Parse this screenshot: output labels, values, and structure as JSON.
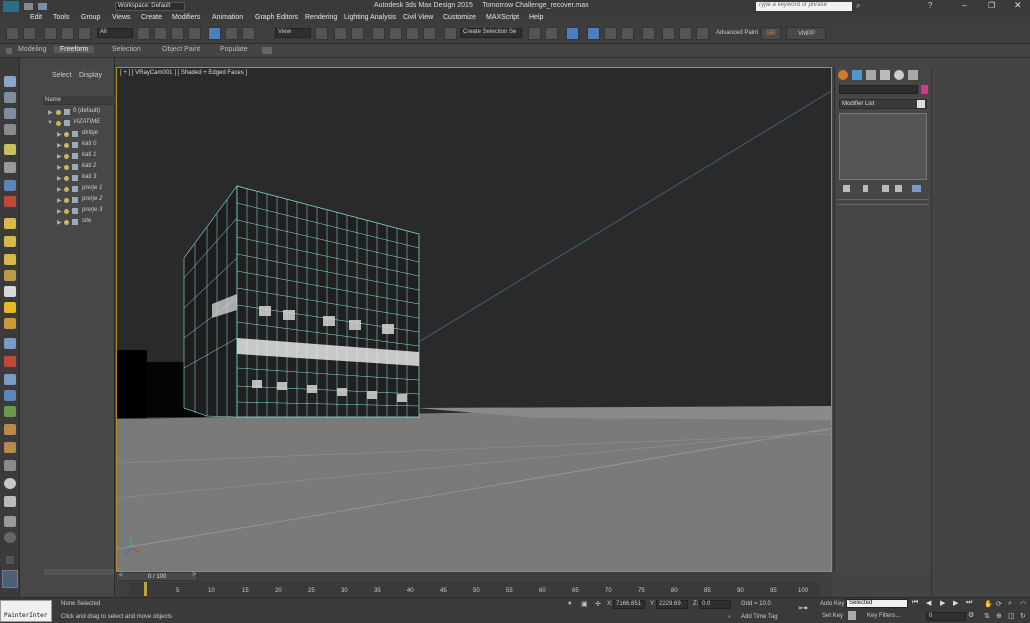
{
  "window": {
    "title": "Autodesk 3ds Max Design 2015     Tomorrow Challenge_recover.max",
    "workspace": "Workspace: Default",
    "search_placeholder": "Type a keyword or phrase"
  },
  "menu": [
    "Edit",
    "Tools",
    "Group",
    "Views",
    "Create",
    "Modifiers",
    "Animation",
    "Graph Editors",
    "Rendering",
    "Lighting Analysis",
    "Civil View",
    "Customize",
    "MAXScript",
    "Help"
  ],
  "toolbar": {
    "filter": "All",
    "ref_coord": "View",
    "selection_set": "Create Selection Se",
    "advanced_paint": "Advanced Paint",
    "sr": "SR",
    "vmpp": "VMPP"
  },
  "ribbon": {
    "tabs": [
      "Modeling",
      "Freeform",
      "Selection",
      "Object Paint",
      "Populate"
    ],
    "active": "Freeform"
  },
  "scene_explorer": {
    "tabs": [
      "Select",
      "Display"
    ],
    "column_header": "Name",
    "items": [
      {
        "label": "0 (default)",
        "level": 0
      },
      {
        "label": "VIZATIME",
        "level": 0
      },
      {
        "label": "diribje",
        "level": 1
      },
      {
        "label": "kati 0",
        "level": 1
      },
      {
        "label": "kati 1",
        "level": 1
      },
      {
        "label": "kati 2",
        "level": 1
      },
      {
        "label": "kati 3",
        "level": 1
      },
      {
        "label": "prerje 1",
        "level": 1
      },
      {
        "label": "prerje 2",
        "level": 1
      },
      {
        "label": "prerje 3",
        "level": 1
      },
      {
        "label": "site",
        "level": 1
      }
    ]
  },
  "viewport": {
    "label": "[ + ] [ VRayCam001 ] [ Shaded + Edged Faces ]"
  },
  "command_panel": {
    "modifier_list": "Modifier List",
    "accent_color": "#d03a8c"
  },
  "timeline": {
    "frame": "0 / 100",
    "ticks": [
      "5",
      "10",
      "15",
      "20",
      "25",
      "30",
      "35",
      "40",
      "45",
      "50",
      "55",
      "60",
      "65",
      "70",
      "75",
      "80",
      "85",
      "90",
      "95",
      "100"
    ]
  },
  "status": {
    "maxscript": "PainterInter",
    "selection": "None Selected",
    "prompt": "Click and drag to select and move objects",
    "x_label": "X:",
    "x_value": "7166.851",
    "y_label": "Y:",
    "y_value": "2229.69",
    "z_label": "Z:",
    "z_value": "0.0",
    "grid": "Grid = 10.0",
    "add_time_tag": "Add Time Tag",
    "auto_key": "Auto Key",
    "set_key": "Set Key",
    "key_mode": "Selected",
    "key_filters": "Key Filters...",
    "current_frame": "0"
  }
}
